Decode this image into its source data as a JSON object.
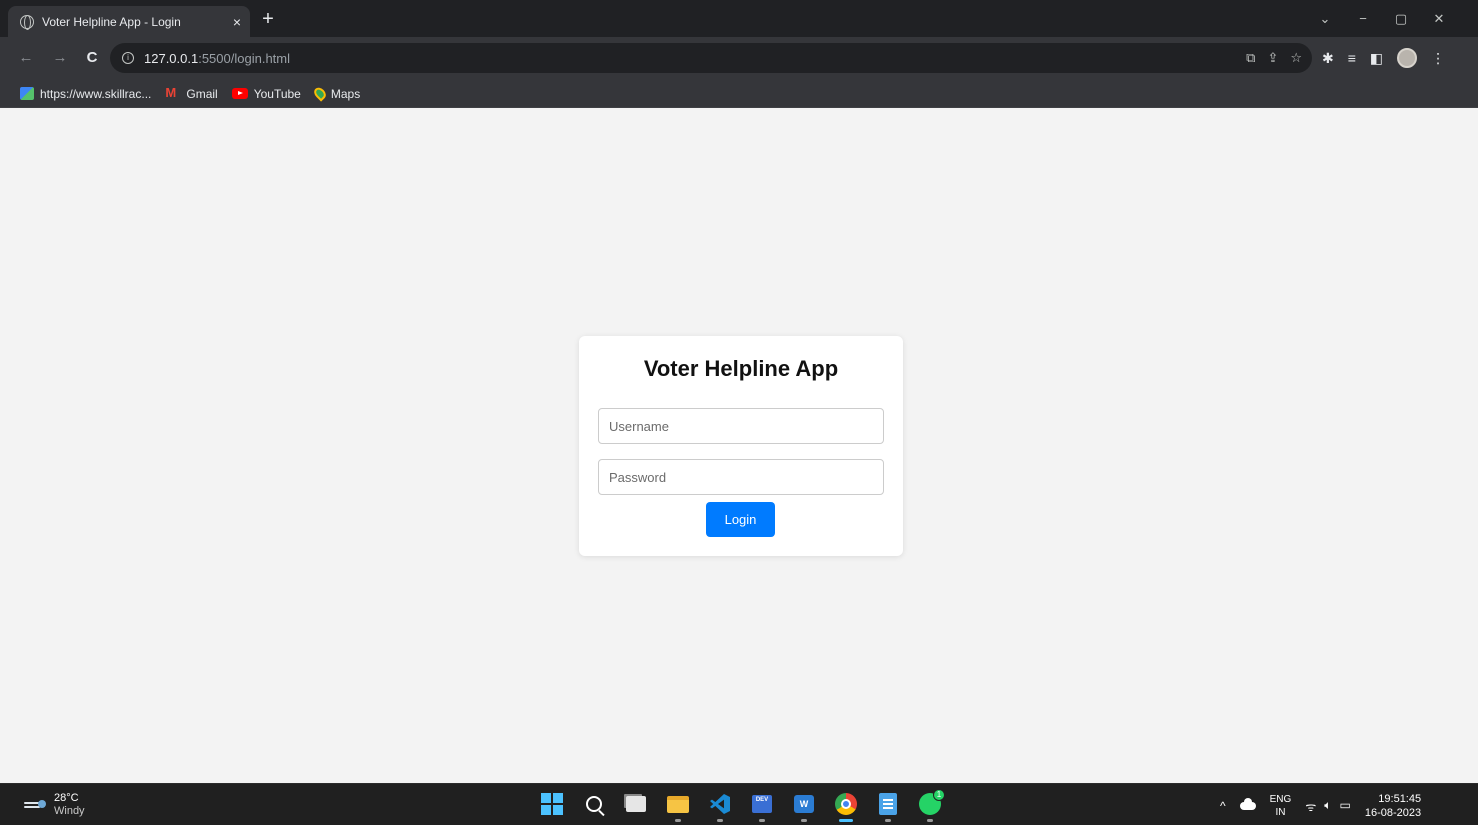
{
  "browser": {
    "tab": {
      "title": "Voter Helpline App - Login",
      "close": "×"
    },
    "new_tab": "+",
    "window_controls": {
      "minimize": "−",
      "restore": "▢",
      "close": "✕",
      "tab_search": "⌄"
    },
    "nav": {
      "back": "←",
      "forward": "→",
      "reload": "C"
    },
    "address": {
      "host": "127.0.0.1",
      "rest": ":5500/login.html"
    },
    "bookmarks": [
      {
        "label": "https://www.skillrac...",
        "icon": "skillrack-icon"
      },
      {
        "label": "Gmail",
        "icon": "gmail-icon"
      },
      {
        "label": "YouTube",
        "icon": "youtube-icon"
      },
      {
        "label": "Maps",
        "icon": "maps-icon"
      }
    ]
  },
  "login": {
    "title": "Voter Helpline App",
    "username_placeholder": "Username",
    "password_placeholder": "Password",
    "button_label": "Login",
    "button_color": "#007bff"
  },
  "taskbar": {
    "weather": {
      "temp": "28°C",
      "condition": "Windy"
    },
    "tray": {
      "lang_line1": "ENG",
      "lang_line2": "IN",
      "time": "19:51:45",
      "date": "16-08-2023"
    },
    "whatsapp_badge": "1"
  },
  "colors": {
    "page_background": "#f3f3f3",
    "chrome_dark": "#202124",
    "chrome_toolbar": "#35363a",
    "accent": "#4cc2ff"
  }
}
